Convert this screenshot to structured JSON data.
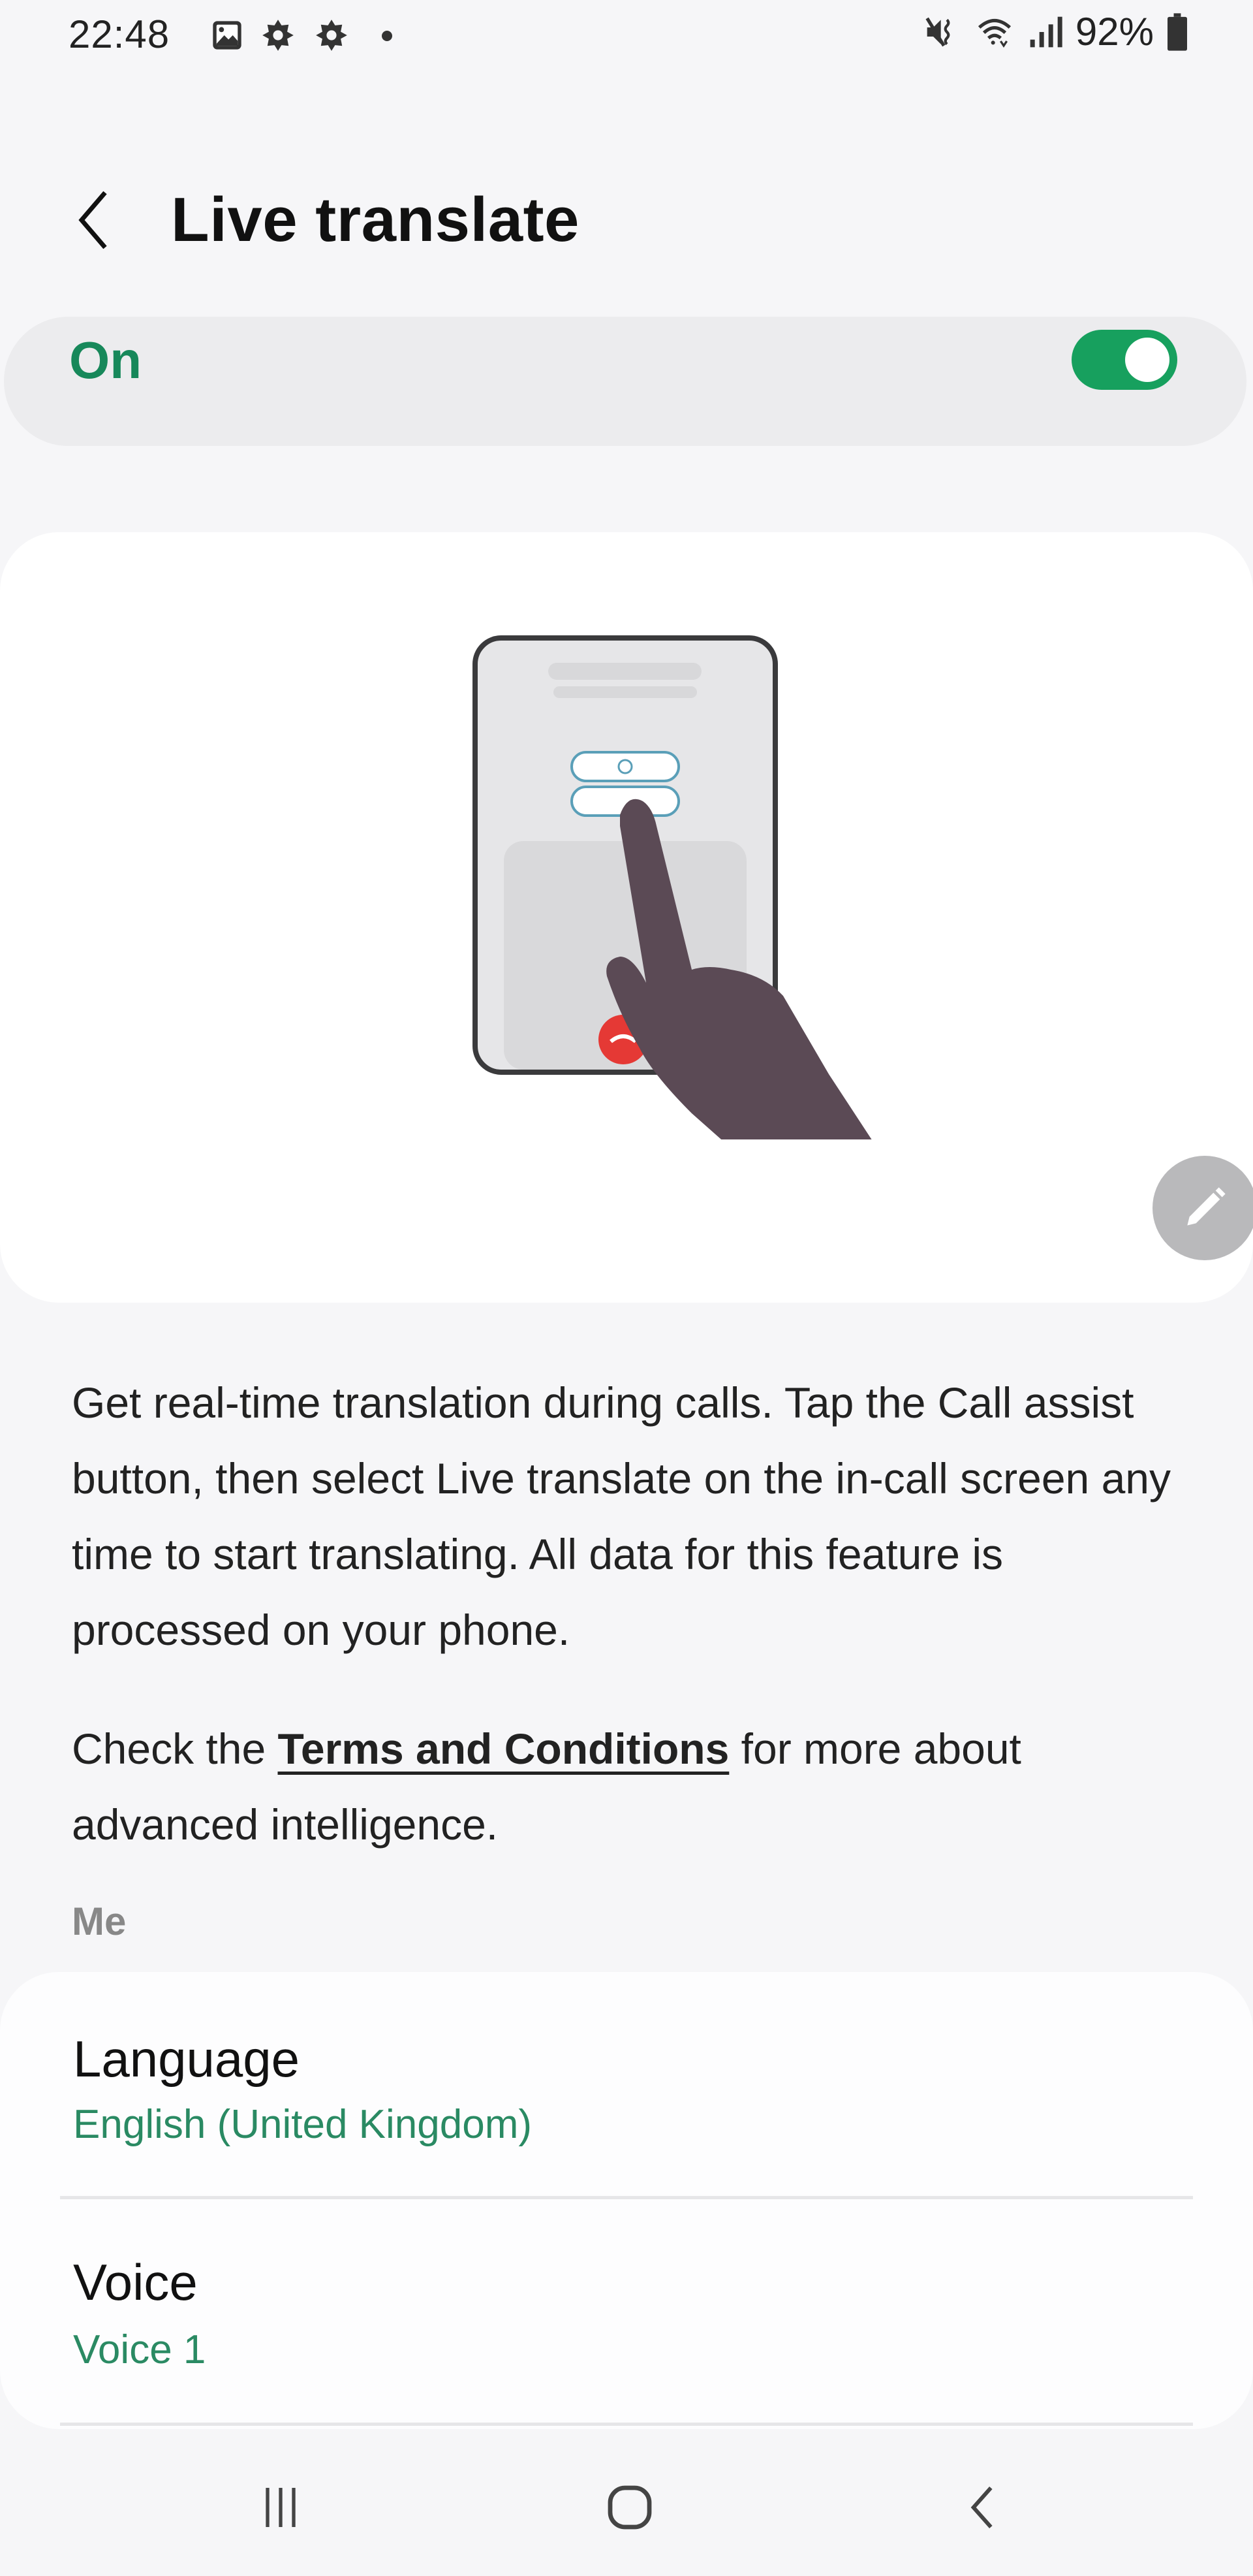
{
  "status_bar": {
    "time": "22:48",
    "left_icons": [
      "gallery-icon",
      "gear-icon",
      "gear-icon",
      "notification-dot-icon"
    ],
    "right_icons": [
      "mute-vibrate-icon",
      "wifi-icon",
      "signal-icon"
    ],
    "battery_percent": "92%"
  },
  "header": {
    "back_icon": "chevron-left-icon",
    "title": "Live translate"
  },
  "master_switch": {
    "label": "On",
    "state": true,
    "accent_color": "#17a05e"
  },
  "illustration": {
    "description": "Phone in-call screen with hand tapping Call assist button",
    "edit_icon": "pencil-icon"
  },
  "description": {
    "text": "Get real-time translation during calls. Tap the Call assist button, then select Live translate on the in-call screen any time to start translating. All data for this feature is processed on your phone."
  },
  "terms": {
    "prefix": "Check the ",
    "link": "Terms and Conditions",
    "suffix": " for more about advanced intelligence."
  },
  "section": {
    "label": "Me",
    "items": [
      {
        "title": "Language",
        "value": "English (United Kingdom)"
      },
      {
        "title": "Voice",
        "value": "Voice 1"
      }
    ]
  },
  "nav_bar": {
    "recents_icon": "recent-apps-icon",
    "home_icon": "home-icon",
    "back_icon": "back-icon"
  }
}
